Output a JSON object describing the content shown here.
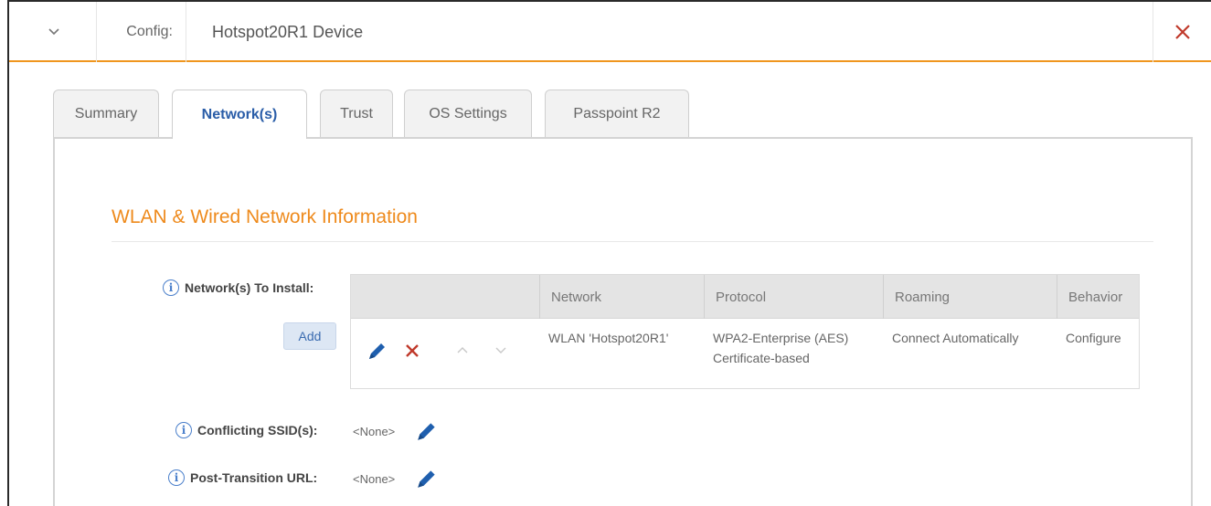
{
  "header": {
    "config_label": "Config:",
    "config_value": "Hotspot20R1 Device"
  },
  "tabs": [
    {
      "label": "Summary"
    },
    {
      "label": "Network(s)",
      "active": true
    },
    {
      "label": "Trust"
    },
    {
      "label": "OS Settings"
    },
    {
      "label": "Passpoint R2"
    }
  ],
  "section": {
    "title": "WLAN & Wired Network Information"
  },
  "networks": {
    "label": "Network(s) To Install:",
    "add_label": "Add",
    "columns": [
      "Network",
      "Protocol",
      "Roaming",
      "Behavior"
    ],
    "rows": [
      {
        "network": "WLAN 'Hotspot20R1'",
        "protocol_line1": "WPA2-Enterprise (AES)",
        "protocol_line2": "Certificate-based",
        "roaming": "Connect Automatically",
        "behavior": "Configure"
      }
    ]
  },
  "conflicting_ssids": {
    "label": "Conflicting SSID(s):",
    "value": "<None>"
  },
  "post_transition_url": {
    "label": "Post-Transition URL:",
    "value": "<None>"
  },
  "colors": {
    "accent_orange": "#ee8a1c",
    "link_blue": "#2a5da8",
    "delete_red": "#c0392b"
  }
}
